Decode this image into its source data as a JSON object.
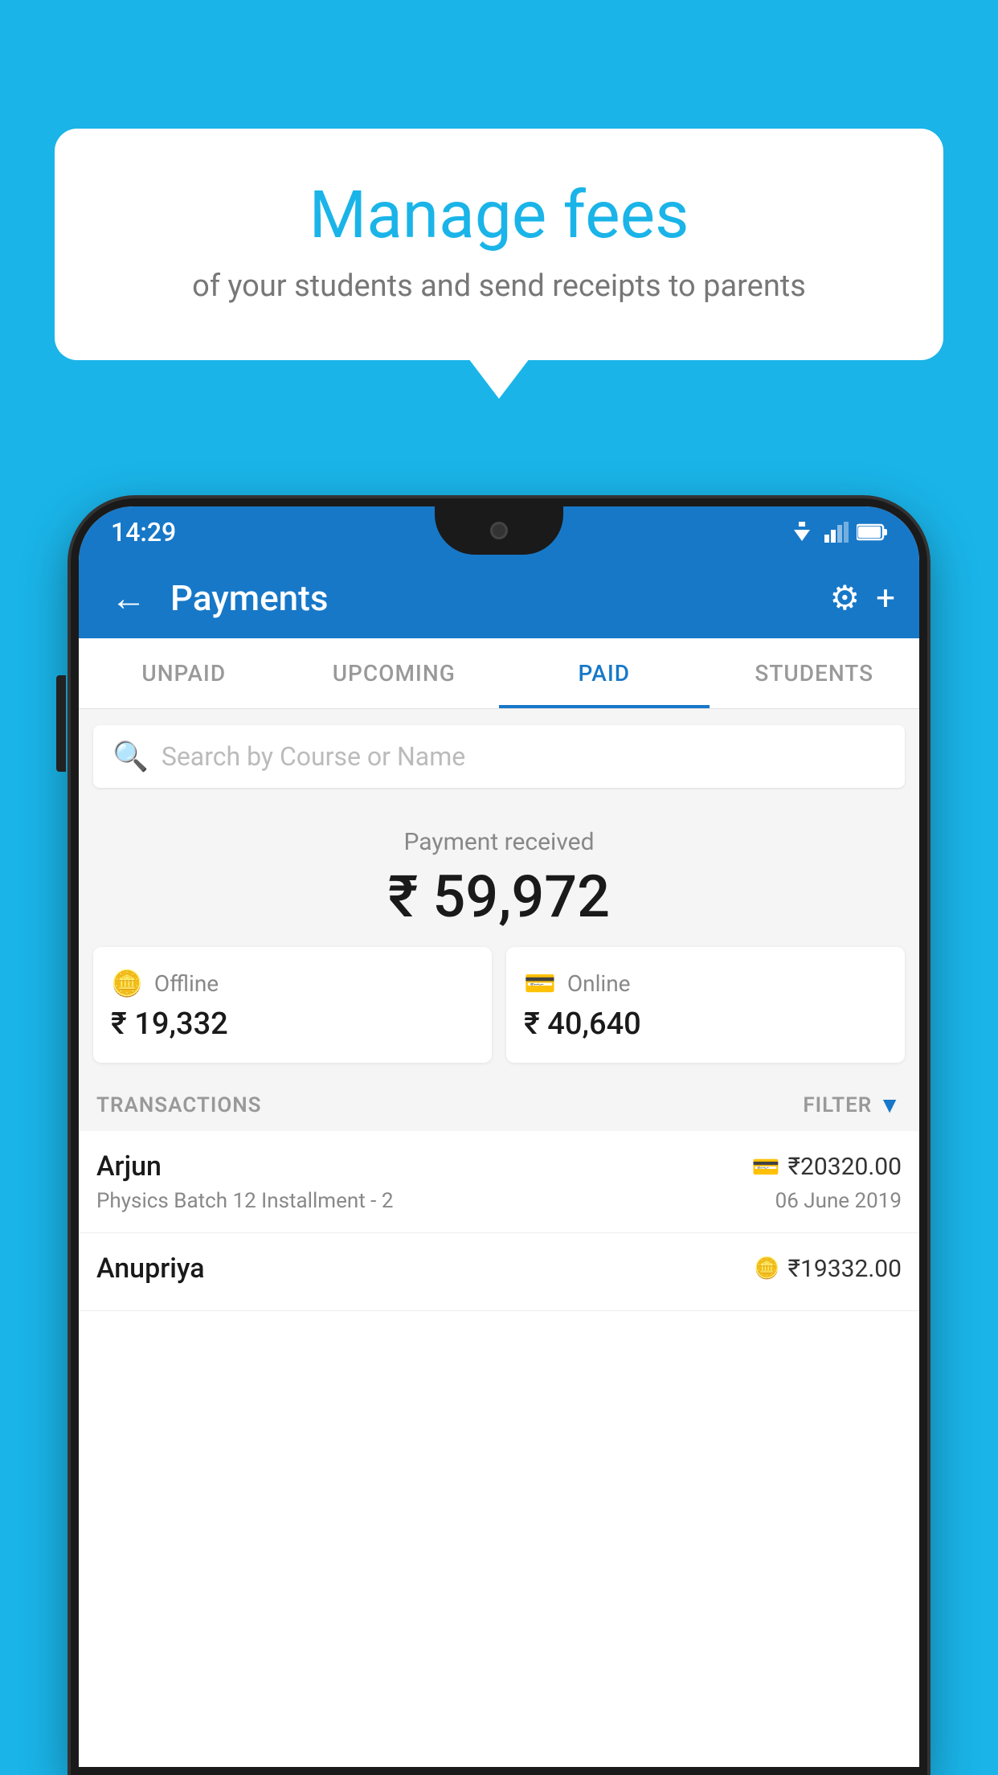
{
  "background_color": "#1ab4e8",
  "speech_bubble": {
    "title": "Manage fees",
    "subtitle": "of your students and send receipts to parents"
  },
  "status_bar": {
    "time": "14:29"
  },
  "app_bar": {
    "title": "Payments",
    "back_label": "←",
    "settings_label": "⚙",
    "add_label": "+"
  },
  "tabs": [
    {
      "id": "unpaid",
      "label": "UNPAID",
      "active": false
    },
    {
      "id": "upcoming",
      "label": "UPCOMING",
      "active": false
    },
    {
      "id": "paid",
      "label": "PAID",
      "active": true
    },
    {
      "id": "students",
      "label": "STUDENTS",
      "active": false
    }
  ],
  "search": {
    "placeholder": "Search by Course or Name"
  },
  "payment_section": {
    "label": "Payment received",
    "total": "₹ 59,972",
    "offline": {
      "label": "Offline",
      "amount": "₹ 19,332"
    },
    "online": {
      "label": "Online",
      "amount": "₹ 40,640"
    }
  },
  "transactions": {
    "section_label": "TRANSACTIONS",
    "filter_label": "FILTER",
    "rows": [
      {
        "name": "Arjun",
        "amount": "₹20320.00",
        "course": "Physics Batch 12 Installment - 2",
        "date": "06 June 2019",
        "type": "online"
      },
      {
        "name": "Anupriya",
        "amount": "₹19332.00",
        "course": "",
        "date": "",
        "type": "offline"
      }
    ]
  }
}
